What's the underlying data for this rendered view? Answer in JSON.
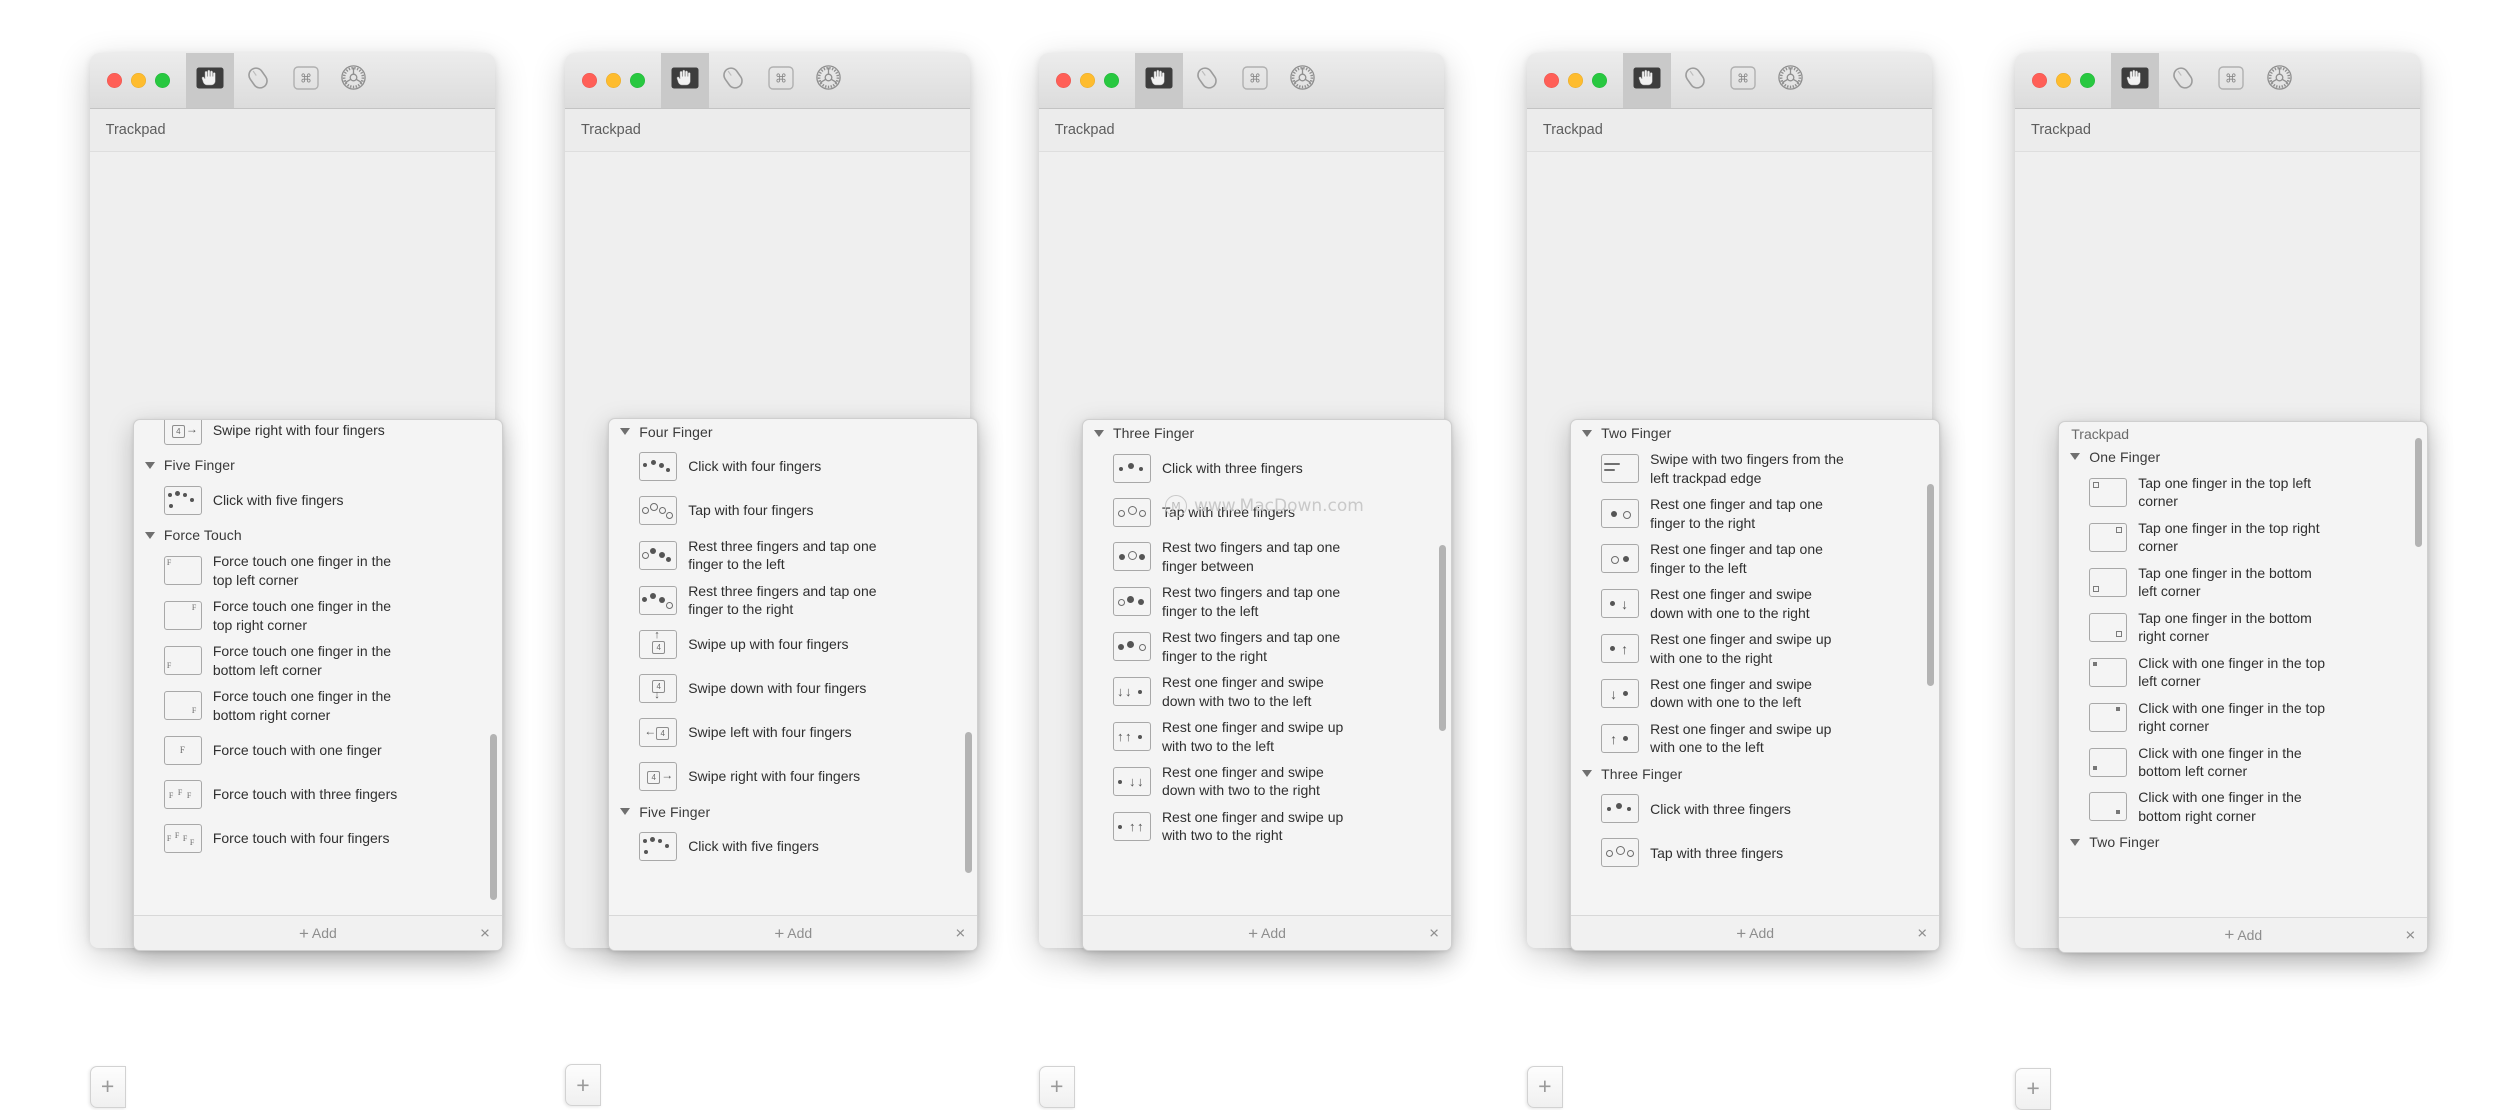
{
  "app": {
    "window_title": "Trackpad",
    "toolbar_icons": [
      "trackpad-hand-icon",
      "mouse-icon",
      "keyboard-command-icon",
      "gear-wheel-icon"
    ],
    "selected_toolbar_index": 0,
    "traffic_lights": [
      "close-button",
      "minimize-button",
      "zoom-button"
    ],
    "add_button_label": "+",
    "popover_footer": {
      "add_label": "Add",
      "add_plus": "+",
      "close_label": "×"
    }
  },
  "watermark": {
    "text": "www.MacDown.com",
    "mark": "M"
  },
  "windows": [
    {
      "id": "window-1",
      "subheader": "Trackpad",
      "popover": {
        "panel_header": null,
        "groups": [
          {
            "label": null,
            "clipped_top": true,
            "items": [
              {
                "text": "Swipe right with four fingers",
                "icon": "swipe-right-four-icon"
              }
            ]
          },
          {
            "label": "Five Finger",
            "items": [
              {
                "text": "Click with five fingers",
                "icon": "click-five-fingers-icon"
              }
            ]
          },
          {
            "label": "Force Touch",
            "items": [
              {
                "text": "Force touch one finger in the top left corner",
                "icon": "force-touch-top-left-icon"
              },
              {
                "text": "Force touch one finger in the top right corner",
                "icon": "force-touch-top-right-icon"
              },
              {
                "text": "Force touch one finger in the bottom left corner",
                "icon": "force-touch-bottom-left-icon"
              },
              {
                "text": "Force touch one finger in the bottom right corner",
                "icon": "force-touch-bottom-right-icon"
              },
              {
                "text": "Force touch with one finger",
                "icon": "force-touch-one-finger-icon"
              },
              {
                "text": "Force touch with three fingers",
                "icon": "force-touch-three-fingers-icon"
              },
              {
                "text": "Force touch with four fingers",
                "icon": "force-touch-four-fingers-icon"
              }
            ]
          }
        ]
      }
    },
    {
      "id": "window-2",
      "subheader": "Trackpad",
      "popover": {
        "panel_header": null,
        "groups": [
          {
            "label": "Four Finger",
            "items": [
              {
                "text": "Click with four fingers",
                "icon": "click-four-fingers-icon"
              },
              {
                "text": "Tap with four fingers",
                "icon": "tap-four-fingers-icon"
              },
              {
                "text": "Rest three fingers and tap one finger to the left",
                "icon": "rest-three-tap-left-icon"
              },
              {
                "text": "Rest three fingers and tap one finger to the right",
                "icon": "rest-three-tap-right-icon"
              },
              {
                "text": "Swipe up with four fingers",
                "icon": "swipe-up-four-icon"
              },
              {
                "text": "Swipe down with four fingers",
                "icon": "swipe-down-four-icon"
              },
              {
                "text": "Swipe left with four fingers",
                "icon": "swipe-left-four-icon"
              },
              {
                "text": "Swipe right with four fingers",
                "icon": "swipe-right-four-icon"
              }
            ]
          },
          {
            "label": "Five Finger",
            "items": [
              {
                "text": "Click with five fingers",
                "icon": "click-five-fingers-icon"
              }
            ]
          }
        ]
      }
    },
    {
      "id": "window-3",
      "subheader": "Trackpad",
      "popover": {
        "panel_header": null,
        "groups": [
          {
            "label": "Three Finger",
            "items": [
              {
                "text": "Click with three fingers",
                "icon": "click-three-fingers-icon"
              },
              {
                "text": "Tap with three fingers",
                "icon": "tap-three-fingers-icon"
              },
              {
                "text": "Rest two fingers and tap one finger between",
                "icon": "rest-two-tap-between-icon"
              },
              {
                "text": "Rest two fingers and tap one finger to the left",
                "icon": "rest-two-tap-left-icon"
              },
              {
                "text": "Rest two fingers and tap one finger to the right",
                "icon": "rest-two-tap-right-icon"
              },
              {
                "text": "Rest one finger and swipe down with two to the left",
                "icon": "rest-one-swipe-down-two-left-icon"
              },
              {
                "text": "Rest one finger and swipe up with two to the left",
                "icon": "rest-one-swipe-up-two-left-icon"
              },
              {
                "text": "Rest one finger and swipe down with two to the right",
                "icon": "rest-one-swipe-down-two-right-icon"
              },
              {
                "text": "Rest one finger and swipe up with two to the right",
                "icon": "rest-one-swipe-up-two-right-icon"
              }
            ]
          }
        ]
      }
    },
    {
      "id": "window-4",
      "subheader": "Trackpad",
      "popover": {
        "panel_header": null,
        "groups": [
          {
            "label": "Two Finger",
            "items": [
              {
                "text": "Swipe with two fingers from the left trackpad edge",
                "icon": "swipe-two-from-left-edge-icon"
              },
              {
                "text": "Rest one finger and tap one finger to the right",
                "icon": "rest-one-tap-one-right-icon"
              },
              {
                "text": "Rest one finger and tap one finger to the left",
                "icon": "rest-one-tap-one-left-icon"
              },
              {
                "text": "Rest one finger and swipe down with one to the right",
                "icon": "rest-one-swipe-down-one-right-icon"
              },
              {
                "text": "Rest one finger and swipe up with one to the right",
                "icon": "rest-one-swipe-up-one-right-icon"
              },
              {
                "text": "Rest one finger and swipe down with one to the left",
                "icon": "rest-one-swipe-down-one-left-icon"
              },
              {
                "text": "Rest one finger and swipe up with one to the left",
                "icon": "rest-one-swipe-up-one-left-icon"
              }
            ]
          },
          {
            "label": "Three Finger",
            "items": [
              {
                "text": "Click with three fingers",
                "icon": "click-three-fingers-icon"
              },
              {
                "text": "Tap with three fingers",
                "icon": "tap-three-fingers-icon"
              }
            ]
          }
        ]
      }
    },
    {
      "id": "window-5",
      "subheader": "Trackpad",
      "popover": {
        "panel_header": "Trackpad",
        "groups": [
          {
            "label": "One Finger",
            "items": [
              {
                "text": "Tap one finger in the top left corner",
                "icon": "tap-one-top-left-icon"
              },
              {
                "text": "Tap one finger in the top right corner",
                "icon": "tap-one-top-right-icon"
              },
              {
                "text": "Tap one finger in the bottom left corner",
                "icon": "tap-one-bottom-left-icon"
              },
              {
                "text": "Tap one finger in the bottom right corner",
                "icon": "tap-one-bottom-right-icon"
              },
              {
                "text": "Click with one finger in the top left corner",
                "icon": "click-one-top-left-icon"
              },
              {
                "text": "Click with one finger in the top right corner",
                "icon": "click-one-top-right-icon"
              },
              {
                "text": "Click with one finger in the bottom left corner",
                "icon": "click-one-bottom-left-icon"
              },
              {
                "text": "Click with one finger in the bottom right corner",
                "icon": "click-one-bottom-right-icon"
              }
            ]
          },
          {
            "label": "Two Finger",
            "items": []
          }
        ]
      }
    }
  ],
  "colors": {
    "background": "#ffffff",
    "window_body": "#efefef",
    "titlebar": "#e4e4e4",
    "popover": "#f4f4f4",
    "text": "#2f2f2f",
    "muted": "#8e8e8e",
    "red": "#ff5f57",
    "yellow": "#febc2e",
    "green": "#28c840"
  }
}
